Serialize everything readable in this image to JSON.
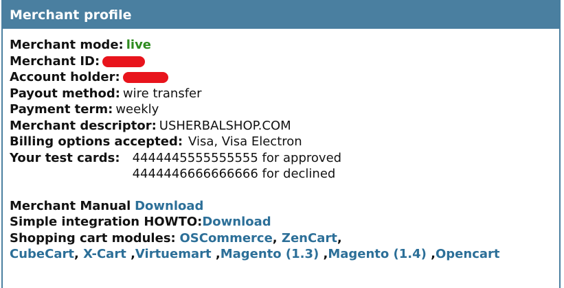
{
  "header": {
    "title": "Merchant profile"
  },
  "profile": {
    "mode_label": "Merchant mode:",
    "mode_value": "live",
    "id_label": "Merchant ID:",
    "holder_label": "Account holder:",
    "payout_label": "Payout method:",
    "payout_value": "wire transfer",
    "term_label": "Payment term:",
    "term_value": "weekly",
    "descriptor_label": "Merchant descriptor:",
    "descriptor_value": "USHERBALSHOP.COM",
    "billing_label": "Billing options accepted:",
    "billing_value": "Visa, Visa Electron",
    "test_label": "Your test cards:",
    "test_cards": [
      "4444445555555555 for approved",
      "4444446666666666 for declined"
    ]
  },
  "resources": {
    "manual_label": "Merchant Manual",
    "manual_link": "Download",
    "howto_label": "Simple integration HOWTO:",
    "howto_link": "Download",
    "modules_label": "Shopping cart modules:",
    "modules": [
      "OSCommerce",
      "ZenCart",
      "CubeCart",
      "X-Cart",
      "Virtuemart",
      "Magento (1.3)",
      "Magento (1.4)",
      "Opencart"
    ]
  },
  "colors": {
    "header_bg": "#4a7fa0",
    "live": "#2e8b1f",
    "link": "#2c6f98",
    "redaction": "#e8141c"
  }
}
